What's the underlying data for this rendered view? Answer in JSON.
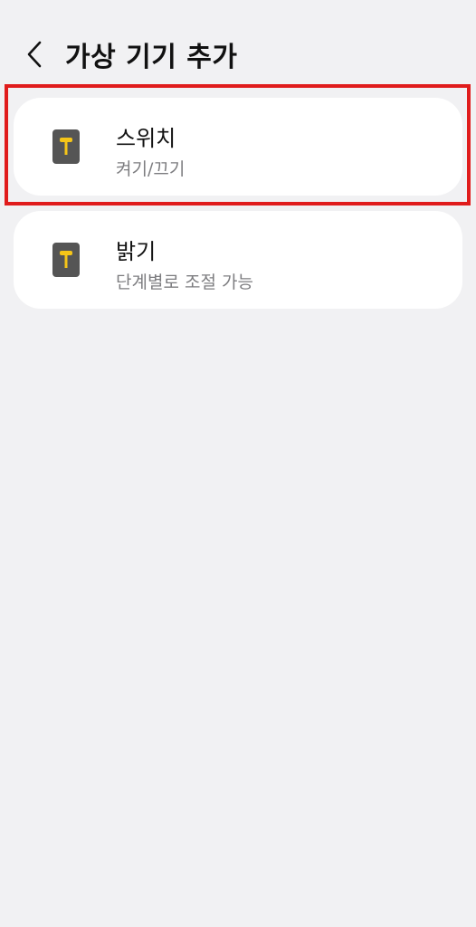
{
  "header": {
    "title": "가상 기기 추가",
    "back_icon": "chevron-left-icon"
  },
  "devices": [
    {
      "title": "스위치",
      "subtitle": "켜기/끄기",
      "icon": "switch-device-icon"
    },
    {
      "title": "밝기",
      "subtitle": "단계별로 조절 가능",
      "icon": "dimmer-device-icon"
    }
  ],
  "colors": {
    "background": "#f1f1f3",
    "card": "#ffffff",
    "icon_body": "#555555",
    "icon_accent": "#f5c518",
    "highlight": "#e01c1c"
  }
}
